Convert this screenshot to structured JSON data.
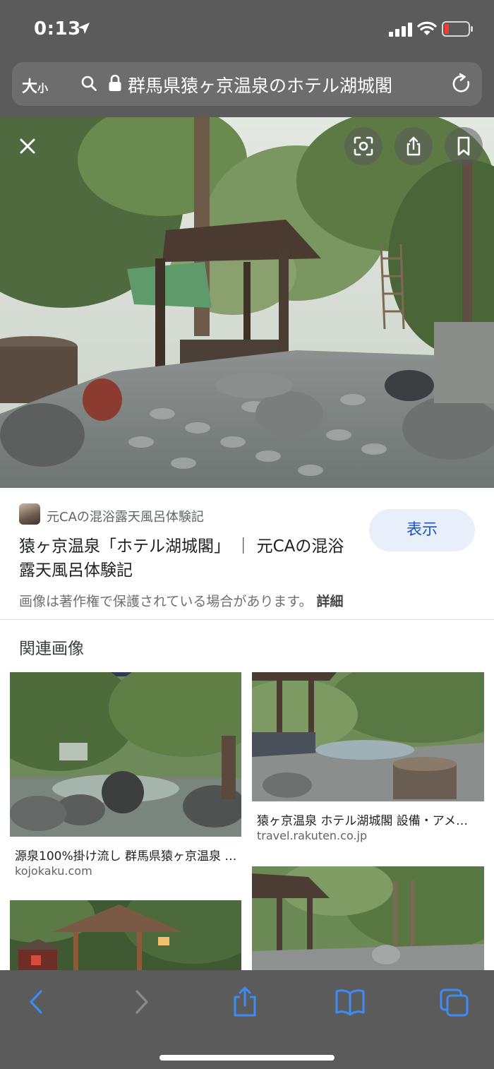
{
  "status_bar": {
    "time": "0:13",
    "battery_color": "#ff3b30"
  },
  "browser": {
    "text_size_big": "大",
    "text_size_small": "小",
    "url_text": "群馬県猿ヶ京温泉のホテル湖城閣"
  },
  "image_viewer": {
    "buttons": [
      "close",
      "lens",
      "share",
      "bookmark"
    ]
  },
  "result": {
    "source_name": "元CAの混浴露天風呂体験記",
    "title": "猿ヶ京温泉「ホテル湖城閣」 ｜ 元CAの混浴露天風呂体験記",
    "show_label": "表示",
    "copyright_notice": "画像は著作権で保護されている場合があります。",
    "detail_label": "詳細"
  },
  "related": {
    "heading": "関連画像",
    "items": [
      {
        "caption": "源泉100%掛け流し 群馬県猿ヶ京温泉 …",
        "domain": "kojokaku.com"
      },
      {
        "caption": "猿ヶ京温泉 ホテル湖城閣 設備・アメ…",
        "domain": "travel.rakuten.co.jp"
      }
    ]
  },
  "toolbar": {
    "items": [
      "back",
      "forward",
      "share",
      "bookmarks",
      "tabs"
    ],
    "accent": "#3d8bf5"
  }
}
